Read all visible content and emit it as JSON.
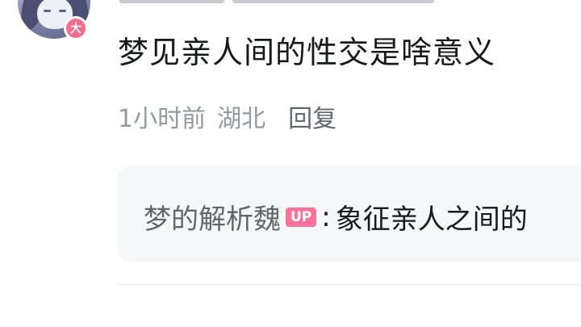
{
  "comment": {
    "level_badge": "大",
    "text": "梦见亲人间的性交是啥意义",
    "time": "1小时前",
    "location": "湖北",
    "reply_label": "回复"
  },
  "reply_preview": {
    "author": "梦的解析魏",
    "badge": "UP",
    "colon": ":",
    "content": "象征亲人之间的"
  },
  "colors": {
    "accent_pink": "#fb7299",
    "meta_gray": "#9499a0",
    "text_dark": "#18191c",
    "reply_bg": "#f6f7f8"
  }
}
